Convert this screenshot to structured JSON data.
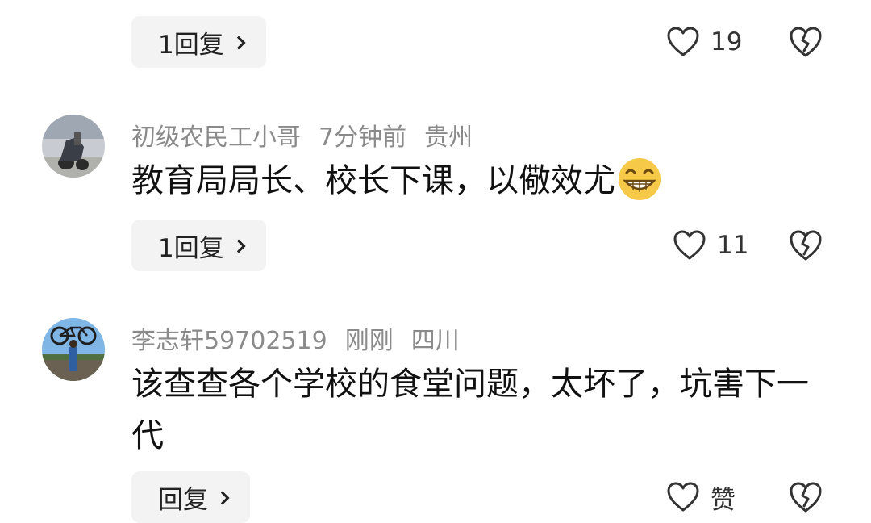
{
  "comments": [
    {
      "reply_label": "1回复",
      "likes": "19"
    },
    {
      "username": "初级农民工小哥",
      "time": "7分钟前",
      "location": "贵州",
      "text": "教育局局长、校长下课，以儆效尤",
      "emoji": "grinning-face-emoji",
      "reply_label": "1回复",
      "likes": "11"
    },
    {
      "username": "李志轩59702519",
      "time": "刚刚",
      "location": "四川",
      "text": "该查查各个学校的食堂问题，太坏了，坑害下一代",
      "reply_label": "回复",
      "likes": "赞"
    }
  ],
  "icons": {
    "like": "heart-outline-icon",
    "dislike": "broken-heart-icon",
    "chevron": "chevron-right-icon"
  },
  "colors": {
    "meta_text": "#8a8a8a",
    "reply_bg": "#f3f3f3",
    "body_text": "#111111"
  }
}
